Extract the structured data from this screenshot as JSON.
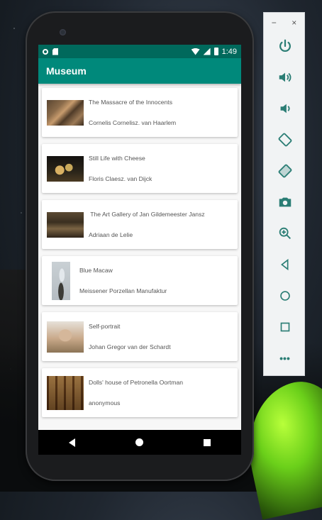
{
  "emulator_controls": {
    "minimize_label": "−",
    "close_label": "×",
    "items": [
      {
        "name": "power-icon"
      },
      {
        "name": "volume-up-icon"
      },
      {
        "name": "volume-down-icon"
      },
      {
        "name": "rotate-left-icon"
      },
      {
        "name": "rotate-right-icon"
      },
      {
        "name": "camera-icon"
      },
      {
        "name": "zoom-icon"
      },
      {
        "name": "back-icon"
      },
      {
        "name": "home-icon"
      },
      {
        "name": "overview-icon"
      },
      {
        "name": "more-icon"
      }
    ],
    "more_label": "•••"
  },
  "status_bar": {
    "time": "1:49"
  },
  "app_bar": {
    "title": "Museum"
  },
  "artworks": [
    {
      "title": "The Massacre of the Innocents",
      "artist": "Cornelis Cornelisz. van Haarlem"
    },
    {
      "title": "Still Life with Cheese",
      "artist": "Floris Claesz. van Dijck"
    },
    {
      "title": " The Art Gallery of Jan Gildemeester Jansz",
      "artist": "Adriaan de Lelie"
    },
    {
      "title": "Blue Macaw",
      "artist": "Meissener Porzellan Manufaktur"
    },
    {
      "title": "Self-portrait",
      "artist": "Johan Gregor van der Schardt"
    },
    {
      "title": "Dolls' house of Petronella Oortman",
      "artist": "anonymous"
    }
  ],
  "colors": {
    "status_bar": "#00695c",
    "app_bar": "#00897b",
    "panel_icon": "#2a7d74"
  }
}
